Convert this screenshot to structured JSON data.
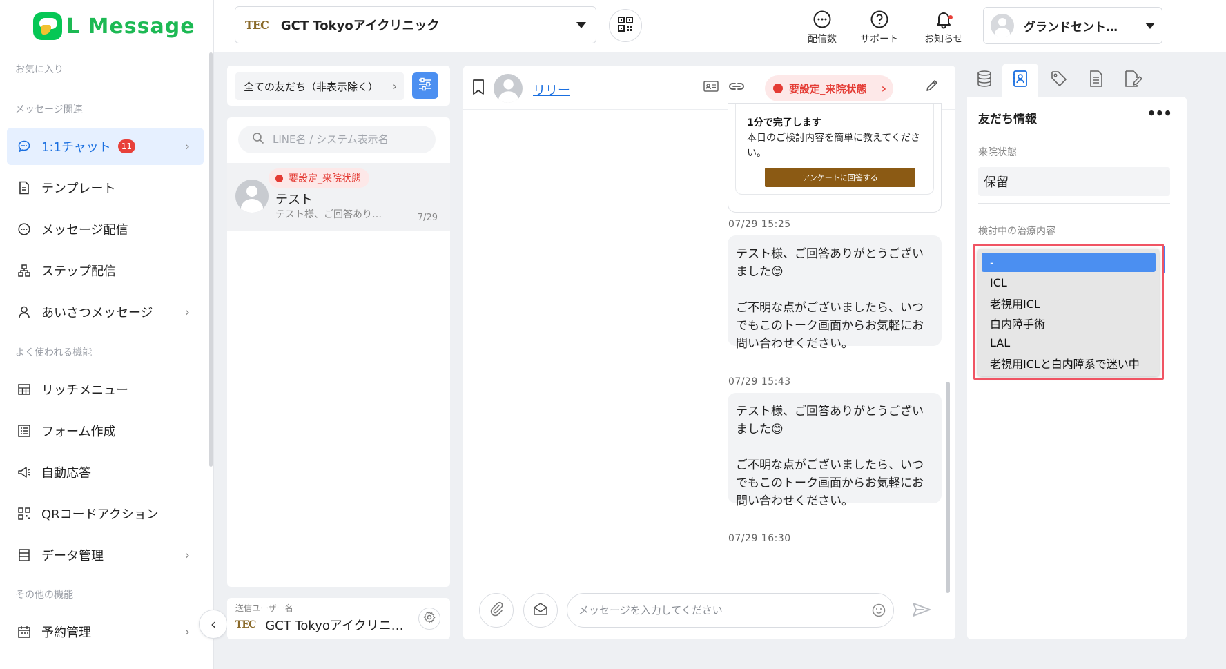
{
  "app": {
    "logo_text": "L Message"
  },
  "sidebar": {
    "sections": {
      "favorites": "お気に入り",
      "message": "メッセージ関連",
      "common": "よく使われる機能",
      "other": "その他の機能"
    },
    "items": [
      {
        "label": "1:1チャット",
        "badge": "11",
        "icon": "chat-icon",
        "active": true
      },
      {
        "label": "テンプレート",
        "icon": "document-icon"
      },
      {
        "label": "メッセージ配信",
        "icon": "message-bubble-icon"
      },
      {
        "label": "ステップ配信",
        "icon": "hierarchy-icon"
      },
      {
        "label": "あいさつメッセージ",
        "icon": "user-icon"
      },
      {
        "label": "リッチメニュー",
        "icon": "grid-menu-icon"
      },
      {
        "label": "フォーム作成",
        "icon": "form-icon"
      },
      {
        "label": "自動応答",
        "icon": "megaphone-icon"
      },
      {
        "label": "QRコードアクション",
        "icon": "qr-icon"
      },
      {
        "label": "データ管理",
        "icon": "list-icon"
      },
      {
        "label": "予約管理",
        "icon": "calendar-icon"
      }
    ]
  },
  "topbar": {
    "account_logo": "TEC",
    "account_name": "GCT Tokyoアイクリニック",
    "delivery_label": "配信数",
    "support_label": "サポート",
    "notice_label": "お知らせ",
    "user_name": "グランドセント…"
  },
  "friend_list": {
    "filter_label": "全ての友だち（非表示除く）",
    "search_placeholder": "LINE名 / システム表示名",
    "friend": {
      "status": "要設定_来院状態",
      "name": "テスト",
      "preview": "テスト様、ご回答あり…",
      "date": "7/29"
    },
    "sender_label": "送信ユーザー名",
    "sender_logo": "TEC",
    "sender_name": "GCT Tokyoアイクリニ…"
  },
  "chat": {
    "user_name": "リリー",
    "status": "要設定_来院状態",
    "survey": {
      "title": "1分で完了します",
      "text": "本日のご検討内容を簡単に教えてください。",
      "button": "アンケートに回答する"
    },
    "timestamps": [
      "07/29 15:25",
      "07/29 15:43",
      "07/29 16:30"
    ],
    "messages": [
      "テスト様、ご回答ありがとうございました😊\n\nご不明な点がございましたら、いつでもこのトーク画面からお気軽にお問い合わせください。",
      "テスト様、ご回答ありがとうございました😊\n\nご不明な点がございましたら、いつでもこのトーク画面からお気軽にお問い合わせください。"
    ],
    "input_placeholder": "メッセージを入力してください"
  },
  "friend_info": {
    "title": "友だち情報",
    "more": "•••",
    "visit_label": "来院状態",
    "visit_value": "保留",
    "treatment_label": "検討中の治療内容",
    "treatment_options": [
      "-",
      "ICL",
      "老視用ICL",
      "白内障手術",
      "LAL",
      "老視用ICLと白内障系で迷い中"
    ],
    "treatment_selected": "-"
  },
  "colors": {
    "accent": "#1a6fe0",
    "brand_green": "#1db954",
    "status_red": "#e43b34",
    "highlight_red": "#f05463",
    "survey_button": "#8b5a14"
  }
}
